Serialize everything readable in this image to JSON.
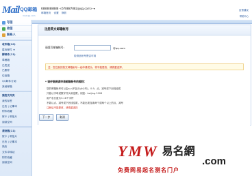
{
  "header": {
    "logo_mark": "Mail",
    "logo_qq": "QQ邮箱",
    "logo_sub": "mail.qq.com",
    "user_line": "6888888888 <678887882@qq.com> ▾",
    "user_links": [
      "邮箱首页",
      "设置",
      "换肤"
    ],
    "right_link": "反馈建议",
    "right_link2": "帮助中心"
  },
  "sidebar": {
    "actions": [
      {
        "label": "写信",
        "color": "#5a9be0"
      },
      {
        "label": "收信",
        "color": "#4aa856"
      },
      {
        "label": "联系人",
        "color": "#e0a23a"
      }
    ],
    "folders": [
      {
        "label": "收件箱(10)",
        "bold": true
      },
      {
        "label": "星标邮件 ★",
        "bold": false
      },
      {
        "label": "群邮件(11)",
        "bold": true
      },
      {
        "label": "草稿箱",
        "bold": false
      },
      {
        "label": "已发送",
        "bold": false
      },
      {
        "label": "已删除",
        "bold": false
      },
      {
        "label": "垃圾箱",
        "bold": false
      },
      {
        "label": "QQ邮件订阅",
        "bold": false
      },
      {
        "label": "其他邮箱",
        "bold": false
      }
    ],
    "group2": [
      {
        "label": "我的文件夹",
        "bold": true
      },
      {
        "label": "我的标签",
        "bold": false
      },
      {
        "label": "日历 | 记事本",
        "bold": false
      },
      {
        "label": "附件收藏",
        "bold": false
      },
      {
        "label": "贺卡 | 明信片",
        "bold": false
      },
      {
        "label": "阅读空间",
        "bold": false
      }
    ],
    "group3": [
      {
        "label": "漂流瓶(11)",
        "bold": true
      },
      {
        "label": "贺卡 | 明信片",
        "bold": false
      },
      {
        "label": "日历 | 记事本",
        "bold": false
      },
      {
        "label": "简历",
        "bold": false
      },
      {
        "label": "文件中转站",
        "bold": false
      },
      {
        "label": "附件收藏",
        "bold": false
      },
      {
        "label": "阅读空间",
        "bold": false
      }
    ]
  },
  "panel": {
    "title": "注册英文邮箱帐号",
    "field_label": "请填写邮箱帐号:",
    "field_value": "",
    "domain": "@qq.com",
    "check_link": "检测此帐号是否可用",
    "warning": "注：您注册的英文邮箱帐号一经申请成功，将不能更改，请慎重选择。",
    "rules_title": "* 请仔细阅读申请邮箱帐号的规则：",
    "rules": [
      "您的邮箱帐号可以由a-z(不区分大小写)、0-9、点、减号或下划线组成",
      "只能以字母或数字开头和结尾，例如：beijing.2008",
      "用户名长度为3-18个字符",
      "不能以点、减号或下划线结尾，不能出现连续两个或两个以上的点、减号",
      "注册后不能更改，请慎重选择"
    ],
    "next_button": "下一步",
    "cancel_button": "取消"
  },
  "watermark": {
    "brand_latin": "YMW",
    "brand_cn": "易名網",
    "dotcom": ".com",
    "slogan": "免费网易起名测名门户"
  }
}
